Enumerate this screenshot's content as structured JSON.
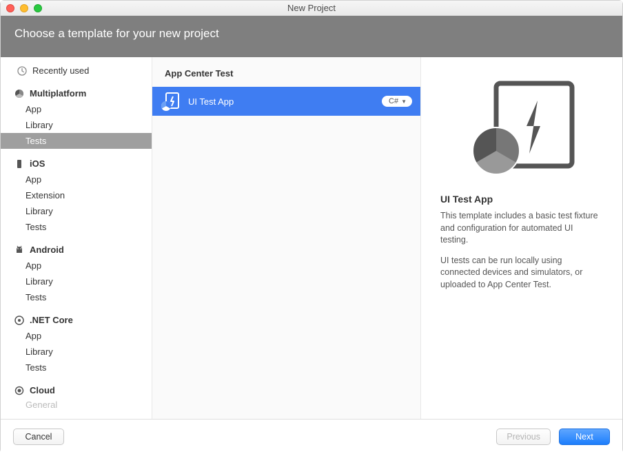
{
  "window": {
    "title": "New Project"
  },
  "header": {
    "text": "Choose a template for your new project"
  },
  "sidebar": {
    "recent": "Recently used",
    "categories": [
      {
        "name": "Multiplatform",
        "items": [
          "App",
          "Library",
          "Tests"
        ],
        "selectedIndex": 2
      },
      {
        "name": "iOS",
        "items": [
          "App",
          "Extension",
          "Library",
          "Tests"
        ]
      },
      {
        "name": "Android",
        "items": [
          "App",
          "Library",
          "Tests"
        ]
      },
      {
        "name": ".NET Core",
        "items": [
          "App",
          "Library",
          "Tests"
        ]
      },
      {
        "name": "Cloud",
        "items": [
          "General"
        ]
      }
    ]
  },
  "center": {
    "heading": "App Center Test",
    "items": [
      {
        "label": "UI Test App",
        "lang": "C#",
        "selected": true
      }
    ]
  },
  "detail": {
    "title": "UI Test App",
    "desc1": "This template includes a basic test fixture and configuration for automated UI testing.",
    "desc2": "UI tests can be run locally using connected devices and simulators, or uploaded to App Center Test."
  },
  "footer": {
    "cancel": "Cancel",
    "previous": "Previous",
    "next": "Next"
  }
}
